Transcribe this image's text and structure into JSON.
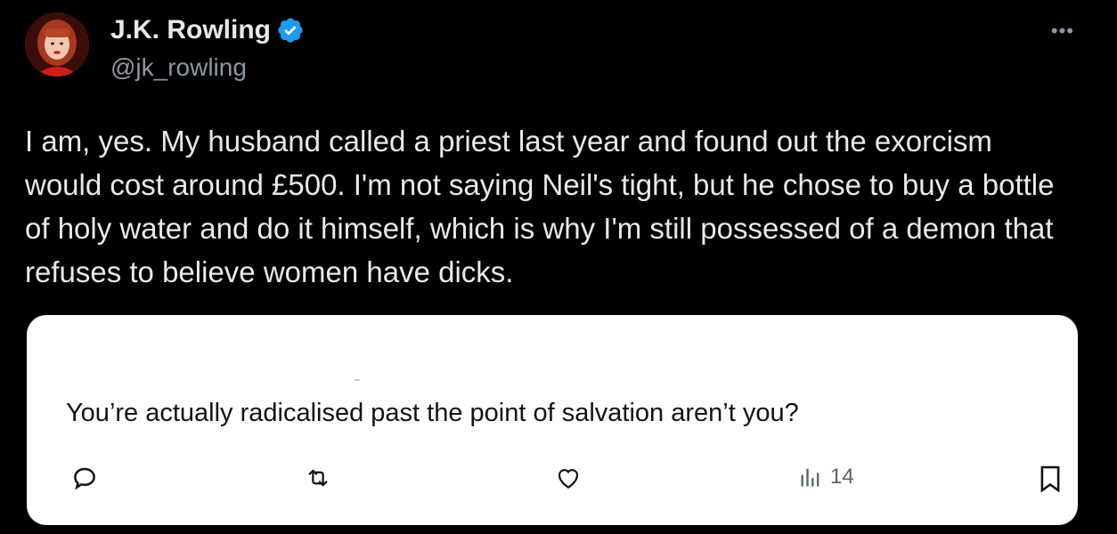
{
  "author": {
    "display_name": "J.K. Rowling",
    "handle": "@jk_rowling",
    "verified_icon": "verified-badge-icon",
    "verified_color": "#1d9bf0"
  },
  "tweet": {
    "text": "I am, yes. My husband called a priest last year and found out the exorcism would cost around £500. I'm not saying Neil's tight, but he chose to buy a bottle of holy water and do it himself, which is why I'm still possessed of a demon that refuses to believe women have dicks."
  },
  "quoted": {
    "text": "You’re actually radicalised past the point of salvation aren’t you?",
    "actions": {
      "reply_icon": "reply-icon",
      "retweet_icon": "retweet-icon",
      "like_icon": "heart-icon",
      "views_icon": "views-icon",
      "views_count": "14",
      "bookmark_icon": "bookmark-icon"
    }
  },
  "more_icon": "more-options-icon"
}
